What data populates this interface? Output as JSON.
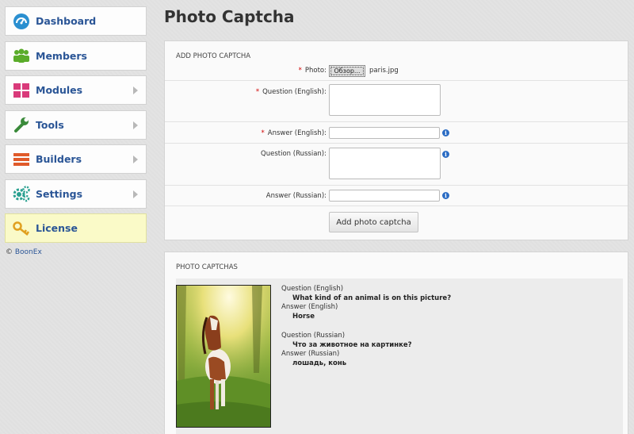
{
  "sidebar": {
    "items": [
      {
        "label": "Dashboard",
        "icon": "dashboard-icon",
        "color": "#2a8fd0"
      },
      {
        "label": "Members",
        "icon": "members-icon",
        "color": "#5aac2a"
      },
      {
        "label": "Modules",
        "icon": "modules-icon",
        "color": "#d93a7a"
      },
      {
        "label": "Tools",
        "icon": "tools-icon",
        "color": "#3a8a3a"
      },
      {
        "label": "Builders",
        "icon": "builders-icon",
        "color": "#e05a2a"
      },
      {
        "label": "Settings",
        "icon": "settings-icon",
        "color": "#2aa090"
      },
      {
        "label": "License",
        "icon": "license-key-icon",
        "color": "#e0a020"
      }
    ],
    "copyright_symbol": "©",
    "copyright_link": "BoonEx"
  },
  "page": {
    "title": "Photo Captcha"
  },
  "add_form": {
    "header": "ADD PHOTO CAPTCHA",
    "required_mark": "*",
    "photo_label": "Photo:",
    "file_button": "Обзор...",
    "file_name": "paris.jpg",
    "question_en_label": "Question (English):",
    "answer_en_label": "Answer (English):",
    "question_ru_label": "Question (Russian):",
    "answer_ru_label": "Answer (Russian):",
    "info_glyph": "i",
    "submit_label": "Add photo captcha"
  },
  "list": {
    "header": "PHOTO CAPTCHAS",
    "items": [
      {
        "question_en_label": "Question (English)",
        "question_en": "What kind of an animal is on this picture?",
        "answer_en_label": "Answer (English)",
        "answer_en": "Horse",
        "question_ru_label": "Question (Russian)",
        "question_ru": "Что за животное на картинке?",
        "answer_ru_label": "Answer (Russian)",
        "answer_ru": "лошадь, конь"
      }
    ]
  }
}
